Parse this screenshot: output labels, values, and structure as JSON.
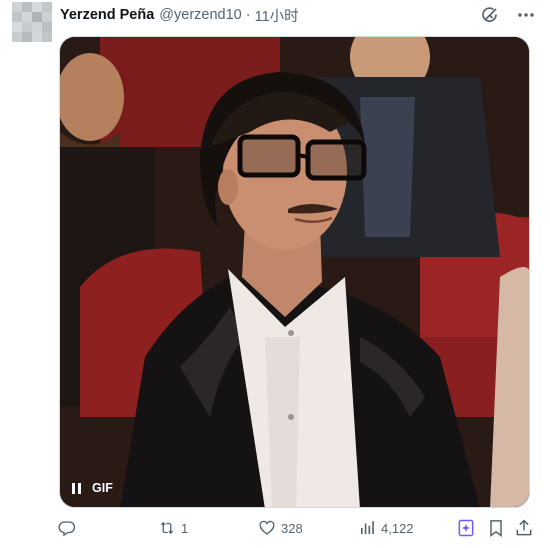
{
  "post": {
    "author_name": "Yerzend Peña",
    "author_handle": "@yerzend10",
    "separator": "·",
    "timestamp": "11小时",
    "media": {
      "type_label": "GIF",
      "state": "playing"
    },
    "stats": {
      "replies": "",
      "reposts": "1",
      "likes": "328",
      "views": "4,122"
    }
  },
  "colors": {
    "text_primary": "#0f1419",
    "text_secondary": "#536471",
    "grok_accent": "#7856ff",
    "border": "#cfd9de"
  },
  "icons": {
    "grok": "grok-icon",
    "more": "more-icon",
    "reply": "reply-icon",
    "retweet": "retweet-icon",
    "like": "heart-icon",
    "views": "views-icon",
    "bookmark": "bookmark-icon",
    "share": "share-icon"
  }
}
